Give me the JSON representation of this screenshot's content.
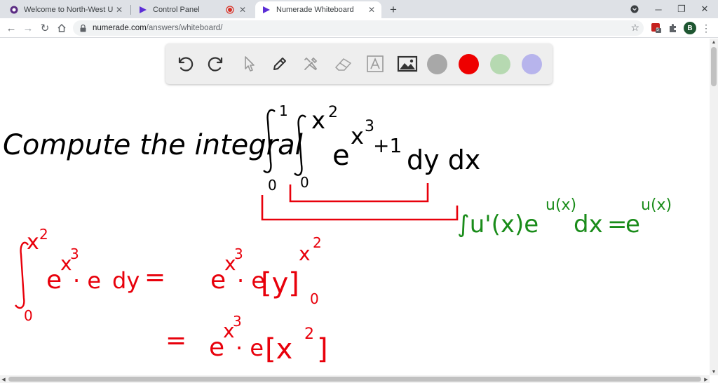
{
  "browser": {
    "tabs": [
      {
        "title": "Welcome to North-West Univers",
        "active": false
      },
      {
        "title": "Control Panel",
        "active": false
      },
      {
        "title": "Numerade Whiteboard",
        "active": true
      }
    ],
    "url_host": "numerade.com",
    "url_path": "/answers/whiteboard/",
    "extension_badge": "5",
    "profile_initial": "B"
  },
  "whiteboard": {
    "tools": [
      "undo-icon",
      "redo-icon",
      "pointer-icon",
      "pen-icon",
      "tools-icon",
      "eraser-icon",
      "text-icon",
      "image-icon"
    ],
    "colors": {
      "gray": "#a8a8a8",
      "red": "#ee0000",
      "green": "#b6d9b1",
      "purple": "#b7b4ec",
      "ink_black": "#000000",
      "ink_red": "#e8000b",
      "ink_green": "#1a8c1a"
    },
    "problem": {
      "prompt": "Compute the integral",
      "outer_upper": "1",
      "outer_lower": "0",
      "inner_upper": "x",
      "inner_upper_exp": "2",
      "inner_lower": "0",
      "integrand_base": "e",
      "integrand_exp_var": "x",
      "integrand_exp_pow": "3",
      "integrand_exp_tail": "+1",
      "differentials": "dy dx"
    },
    "hint": {
      "lhs_open": "∫u'(x)e",
      "lhs_exp": "u(x)",
      "lhs_dx": "dx",
      "equals": "=",
      "rhs_base": "e",
      "rhs_exp": "u(x)"
    },
    "work": {
      "line1_upper": "x",
      "line1_upper_exp": "2",
      "line1_lower": "0",
      "line1_e": "e",
      "line1_exp_var": "x",
      "line1_exp_pow": "3",
      "line1_dot_e": "· e",
      "line1_dy": "dy",
      "line1_eq": "=",
      "line1_rhs_e": "e",
      "line1_rhs_exp_var": "x",
      "line1_rhs_exp_pow": "3",
      "line1_rhs_dot_e": "· e",
      "line1_bracket": "[y]",
      "line1_bracket_upper": "x",
      "line1_bracket_upper_exp": "2",
      "line1_bracket_lower": "0",
      "line2_eq": "=",
      "line2_e": "e",
      "line2_exp_var": "x",
      "line2_exp_pow": "3",
      "line2_dot_e": "· e",
      "line2_bracket": "[x",
      "line2_bracket_exp": "2",
      "line2_close": "]"
    }
  }
}
